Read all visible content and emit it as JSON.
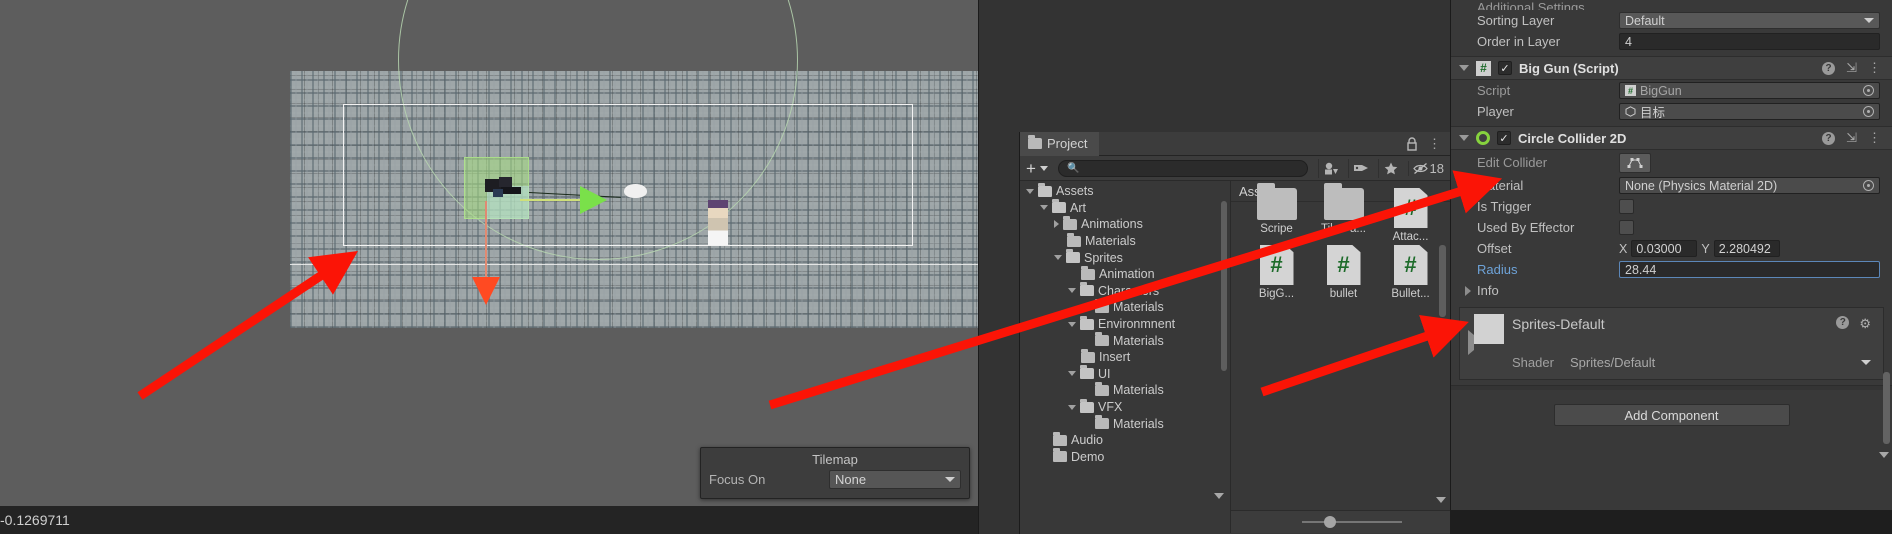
{
  "scene": {
    "status_text": "-0.1269711",
    "tilemap_overlay": {
      "title": "Tilemap",
      "focus_label": "Focus On",
      "focus_value": "None"
    }
  },
  "project": {
    "tab_label": "Project",
    "lock_icon": "lock-icon",
    "menu_icon": "kebab-icon",
    "search_placeholder": "",
    "search_value": "",
    "toolbar_icons": [
      "search-by-type-icon",
      "label-icon",
      "favorite-star-icon"
    ],
    "hidden_count": "18",
    "breadcrumb": "Assets",
    "tree": [
      {
        "label": "Assets",
        "depth": 0,
        "twisty": "down",
        "open": true
      },
      {
        "label": "Art",
        "depth": 1,
        "twisty": "down",
        "open": true
      },
      {
        "label": "Animations",
        "depth": 2,
        "twisty": "right",
        "open": false
      },
      {
        "label": "Materials",
        "depth": 2,
        "twisty": "none",
        "open": false
      },
      {
        "label": "Sprites",
        "depth": 2,
        "twisty": "down",
        "open": true
      },
      {
        "label": "Animation",
        "depth": 3,
        "twisty": "none",
        "open": false
      },
      {
        "label": "Characters",
        "depth": 3,
        "twisty": "down",
        "open": true
      },
      {
        "label": "Materials",
        "depth": 4,
        "twisty": "none",
        "open": false
      },
      {
        "label": "Environmnent",
        "depth": 3,
        "twisty": "down",
        "open": true
      },
      {
        "label": "Materials",
        "depth": 4,
        "twisty": "none",
        "open": false
      },
      {
        "label": "Insert",
        "depth": 3,
        "twisty": "none",
        "open": false
      },
      {
        "label": "UI",
        "depth": 3,
        "twisty": "down",
        "open": true
      },
      {
        "label": "Materials",
        "depth": 4,
        "twisty": "none",
        "open": false
      },
      {
        "label": "VFX",
        "depth": 3,
        "twisty": "down",
        "open": true
      },
      {
        "label": "Materials",
        "depth": 4,
        "twisty": "none",
        "open": false
      },
      {
        "label": "Audio",
        "depth": 1,
        "twisty": "none",
        "open": false
      },
      {
        "label": "Demo",
        "depth": 1,
        "twisty": "none",
        "open": false
      }
    ],
    "grid_items": [
      {
        "label": "Scripe",
        "kind": "folder"
      },
      {
        "label": "Tile Pa...",
        "kind": "folder"
      },
      {
        "label": "Attac...",
        "kind": "script"
      },
      {
        "label": "BigG...",
        "kind": "script"
      },
      {
        "label": "bullet",
        "kind": "script"
      },
      {
        "label": "Bullet...",
        "kind": "script"
      }
    ]
  },
  "inspector": {
    "additional_settings_clipped": "Additional Settings",
    "sorting_layer": {
      "label": "Sorting Layer",
      "value": "Default"
    },
    "order_in_layer": {
      "label": "Order in Layer",
      "value": "4"
    },
    "big_gun": {
      "title": "Big Gun (Script)",
      "enabled": true,
      "script": {
        "label": "Script",
        "value": "BigGun"
      },
      "player": {
        "label": "Player",
        "value": "目标"
      }
    },
    "circle_collider": {
      "title": "Circle Collider 2D",
      "enabled": true,
      "edit_collider": {
        "label": "Edit Collider"
      },
      "material": {
        "label": "Material",
        "value": "None (Physics Material 2D)"
      },
      "is_trigger": {
        "label": "Is Trigger",
        "checked": false
      },
      "used_by_effector": {
        "label": "Used By Effector",
        "checked": false
      },
      "offset": {
        "label": "Offset",
        "x_axis": "X",
        "x": "0.03000",
        "y_axis": "Y",
        "y": "2.280492"
      },
      "radius": {
        "label": "Radius",
        "value": "28.44",
        "highlighted": true
      },
      "info": {
        "label": "Info"
      }
    },
    "material_preview": {
      "name": "Sprites-Default",
      "shader_label": "Shader",
      "shader_value": "Sprites/Default"
    },
    "add_component_label": "Add Component"
  },
  "colors": {
    "accent_blue": "#6ea3d8",
    "annotation_red": "#fb1406",
    "collider_green": "#86d23e",
    "script_green": "#1d6b2a"
  }
}
